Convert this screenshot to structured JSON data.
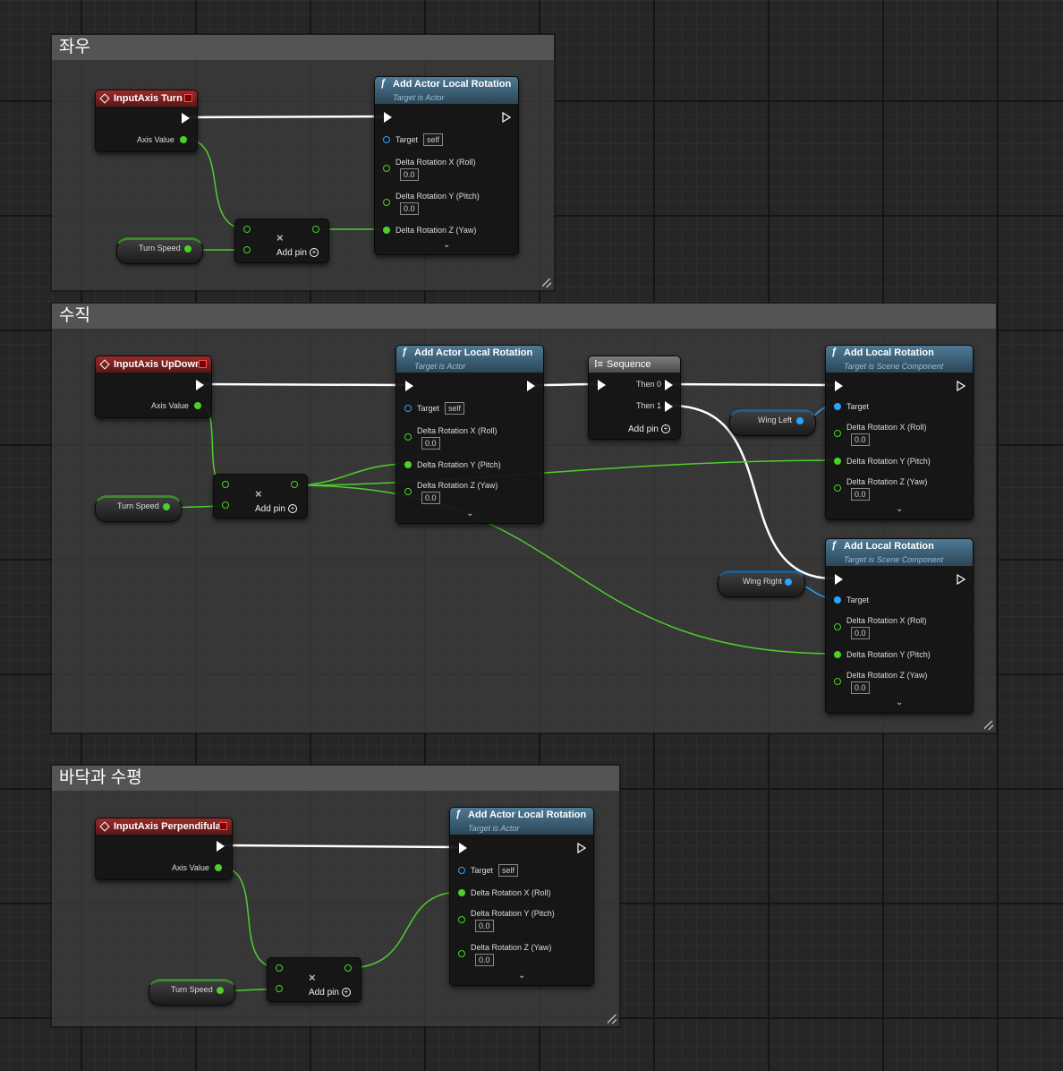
{
  "comments": [
    {
      "title": "좌우"
    },
    {
      "title": "수직"
    },
    {
      "title": "바닥과 수평"
    }
  ],
  "nodes": {
    "input_turn": {
      "title": "InputAxis Turn",
      "axis_label": "Axis Value"
    },
    "input_updown": {
      "title": "InputAxis UpDown",
      "axis_label": "Axis Value"
    },
    "input_perp": {
      "title": "InputAxis Perpendifular",
      "axis_label": "Axis Value"
    },
    "add_actor_rot": {
      "title": "Add Actor Local Rotation",
      "subtitle": "Target is Actor"
    },
    "add_local_rot": {
      "title": "Add Local Rotation",
      "subtitle": "Target is Scene Component"
    },
    "sequence": {
      "title": "Sequence",
      "then0": "Then 0",
      "then1": "Then 1"
    },
    "multiply": {
      "symbol": "×",
      "add_pin": "Add pin"
    }
  },
  "pins": {
    "target": "Target",
    "self": "self",
    "roll": "Delta Rotation X (Roll)",
    "pitch": "Delta Rotation Y (Pitch)",
    "yaw": "Delta Rotation Z (Yaw)",
    "zero": "0.0",
    "add_pin": "Add pin"
  },
  "variables": {
    "turn_speed": "Turn Speed",
    "wing_left": "Wing Left",
    "wing_right": "Wing Right"
  },
  "colors": {
    "exec": "#ffffff",
    "float": "#4ccf2a",
    "object": "#2aa4ff",
    "event_header": "#8a2323",
    "function_header": "#3f6a84"
  },
  "icons": {
    "function": "function-icon",
    "event": "event-diamond-icon",
    "sequence": "sequence-icon",
    "expand": "chevron-down-icon"
  }
}
